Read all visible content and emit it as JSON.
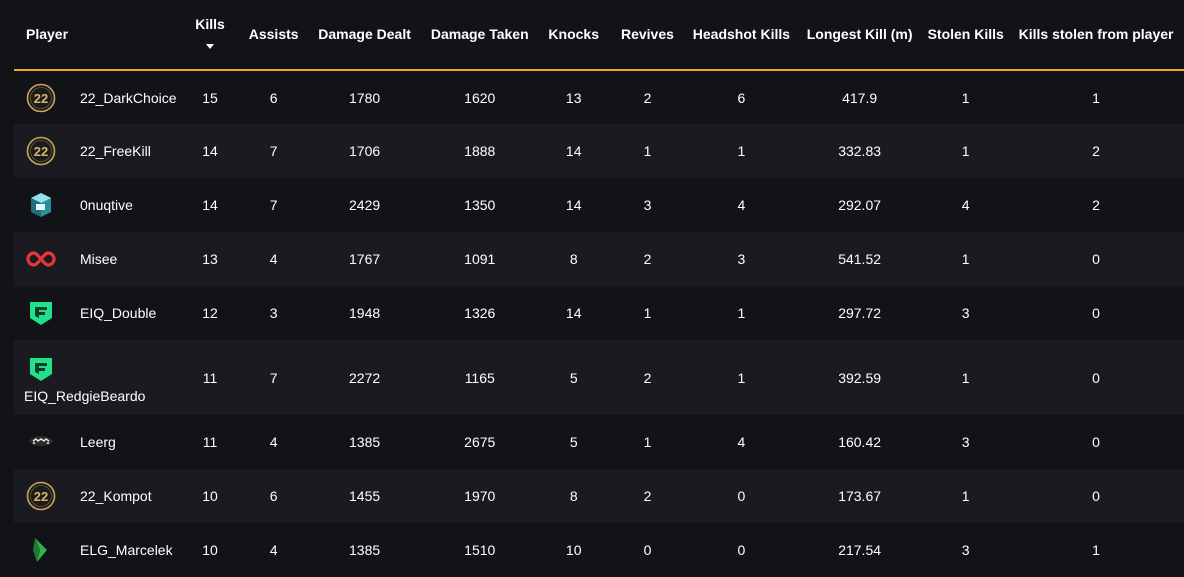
{
  "header": {
    "player": "Player",
    "kills": "Kills",
    "assists": "Assists",
    "damage_dealt": "Damage Dealt",
    "damage_taken": "Damage Taken",
    "knocks": "Knocks",
    "revives": "Revives",
    "headshot_kills": "Headshot Kills",
    "longest_kill": "Longest Kill (m)",
    "stolen_kills": "Stolen Kills",
    "kills_stolen_from": "Kills stolen from player"
  },
  "sort": {
    "column": "kills",
    "direction": "descending"
  },
  "colors": {
    "accent": "#f5a623",
    "row_alt": "#1a1b20",
    "background": "#121316"
  },
  "rows": [
    {
      "team_logo": "22-logo",
      "player": "22_DarkChoice",
      "kills": "15",
      "assists": "6",
      "damage_dealt": "1780",
      "damage_taken": "1620",
      "knocks": "13",
      "revives": "2",
      "headshot_kills": "6",
      "longest_kill": "417.9",
      "stolen_kills": "1",
      "kills_stolen_from": "1"
    },
    {
      "team_logo": "22-logo",
      "player": "22_FreeKill",
      "kills": "14",
      "assists": "7",
      "damage_dealt": "1706",
      "damage_taken": "1888",
      "knocks": "14",
      "revives": "1",
      "headshot_kills": "1",
      "longest_kill": "332.83",
      "stolen_kills": "1",
      "kills_stolen_from": "2"
    },
    {
      "team_logo": "cube-logo",
      "player": "0nuqtive",
      "kills": "14",
      "assists": "7",
      "damage_dealt": "2429",
      "damage_taken": "1350",
      "knocks": "14",
      "revives": "3",
      "headshot_kills": "4",
      "longest_kill": "292.07",
      "stolen_kills": "4",
      "kills_stolen_from": "2"
    },
    {
      "team_logo": "infinity-logo",
      "player": "Misee",
      "kills": "13",
      "assists": "4",
      "damage_dealt": "1767",
      "damage_taken": "1091",
      "knocks": "8",
      "revives": "2",
      "headshot_kills": "3",
      "longest_kill": "541.52",
      "stolen_kills": "1",
      "kills_stolen_from": "0"
    },
    {
      "team_logo": "eiq-logo",
      "player": "EIQ_Double",
      "kills": "12",
      "assists": "3",
      "damage_dealt": "1948",
      "damage_taken": "1326",
      "knocks": "14",
      "revives": "1",
      "headshot_kills": "1",
      "longest_kill": "297.72",
      "stolen_kills": "3",
      "kills_stolen_from": "0"
    },
    {
      "team_logo": "eiq-logo",
      "player": "EIQ_RedgieBeardo",
      "kills": "11",
      "assists": "7",
      "damage_dealt": "2272",
      "damage_taken": "1165",
      "knocks": "5",
      "revives": "2",
      "headshot_kills": "1",
      "longest_kill": "392.59",
      "stolen_kills": "1",
      "kills_stolen_from": "0"
    },
    {
      "team_logo": "mask-logo",
      "player": "Leerg",
      "kills": "11",
      "assists": "4",
      "damage_dealt": "1385",
      "damage_taken": "2675",
      "knocks": "5",
      "revives": "1",
      "headshot_kills": "4",
      "longest_kill": "160.42",
      "stolen_kills": "3",
      "kills_stolen_from": "0"
    },
    {
      "team_logo": "22-logo",
      "player": "22_Kompot",
      "kills": "10",
      "assists": "6",
      "damage_dealt": "1455",
      "damage_taken": "1970",
      "knocks": "8",
      "revives": "2",
      "headshot_kills": "0",
      "longest_kill": "173.67",
      "stolen_kills": "1",
      "kills_stolen_from": "0"
    },
    {
      "team_logo": "elg-logo",
      "player": "ELG_Marcelek",
      "kills": "10",
      "assists": "4",
      "damage_dealt": "1385",
      "damage_taken": "1510",
      "knocks": "10",
      "revives": "0",
      "headshot_kills": "0",
      "longest_kill": "217.54",
      "stolen_kills": "3",
      "kills_stolen_from": "1"
    }
  ]
}
